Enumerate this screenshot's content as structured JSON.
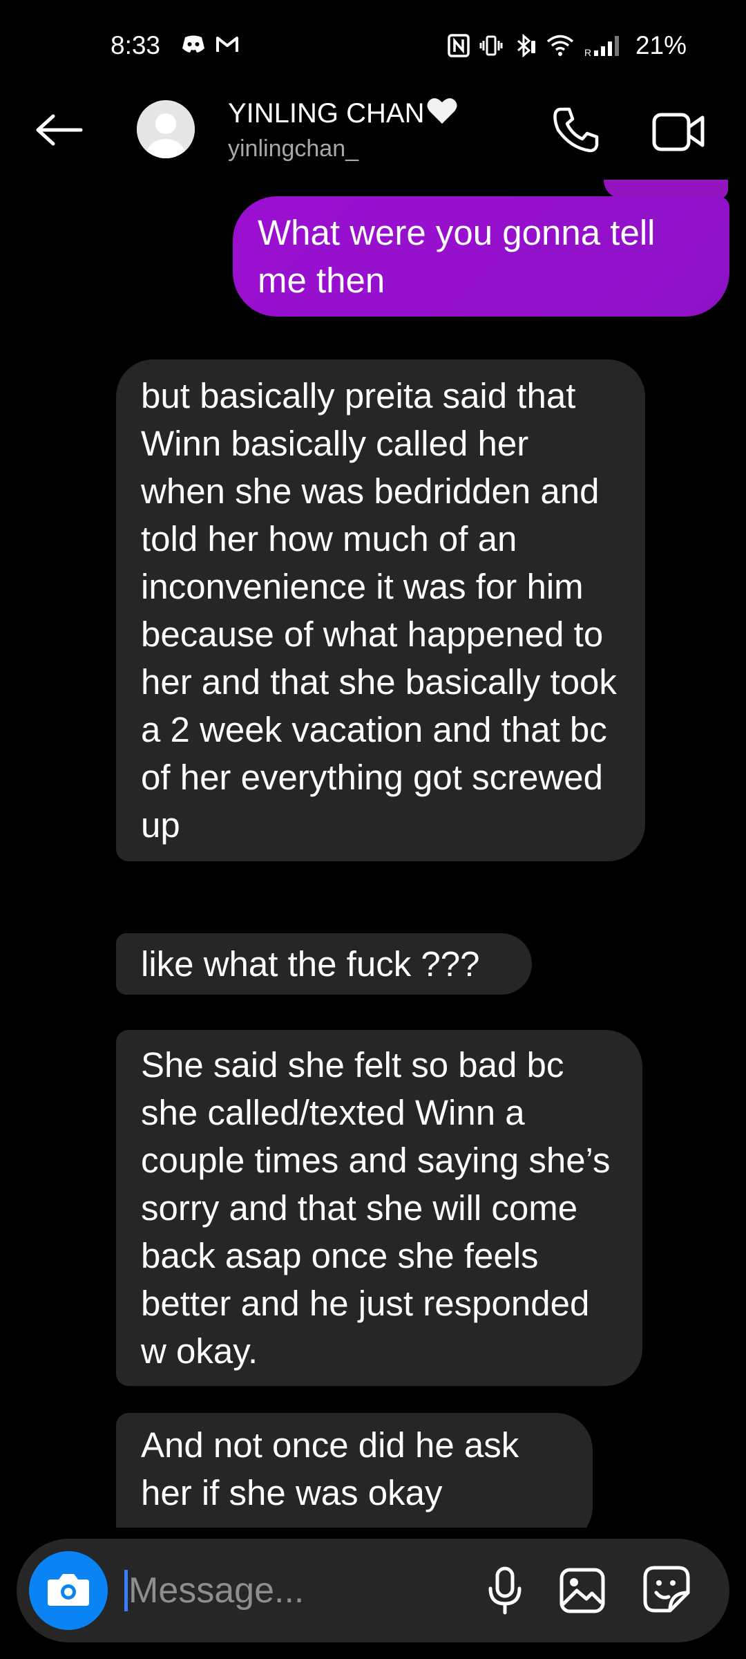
{
  "status_bar": {
    "time": "8:33",
    "battery": "21%",
    "icons": [
      "discord-icon",
      "gmail-icon",
      "nfc-icon",
      "vibrate-icon",
      "bluetooth-icon",
      "wifi-icon",
      "signal-icon"
    ]
  },
  "header": {
    "contact_name": "YINLING CHAN",
    "username": "yinlingchan_",
    "icons": [
      "back-arrow-icon",
      "avatar-icon",
      "phone-icon",
      "video-icon",
      "white-heart-icon"
    ]
  },
  "messages": [
    {
      "sender": "me",
      "text": "What were you gonna tell me then"
    },
    {
      "sender": "them",
      "text": "but basically preita said that Winn basically called her when she was bedridden and told her how much of an inconvenience it was for him because of what happened to her and that she basically took a 2 week vacation and that bc of her everything got screwed up"
    },
    {
      "sender": "them",
      "text": "like what the fuck ???"
    },
    {
      "sender": "them",
      "text": "She said she felt so bad bc she called/texted Winn a couple times and saying she’s sorry and that she will come back asap once she feels better and he just responded w okay."
    },
    {
      "sender": "them",
      "text": "And not once did he ask her if she was okay"
    }
  ],
  "composer": {
    "placeholder": "Message...",
    "value": "",
    "icons": [
      "camera-icon",
      "microphone-icon",
      "gallery-icon",
      "sticker-icon"
    ]
  },
  "colors": {
    "background": "#000000",
    "sent_bubble": "#9b0fd1",
    "received_bubble": "#262626",
    "camera_button": "#0a84f5",
    "username": "#a8a8a8"
  }
}
